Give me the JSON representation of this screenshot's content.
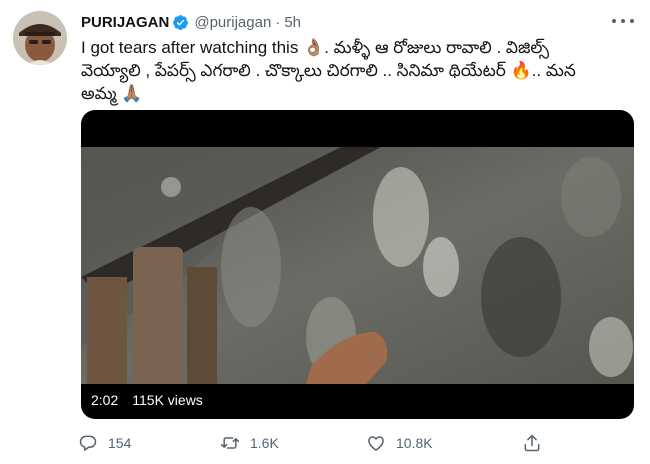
{
  "author": {
    "name": "PURIJAGAN",
    "handle": "@purijagan",
    "separator": "·",
    "time": "5h",
    "avatar_icon": "avatar-photo"
  },
  "tweet": {
    "lines": [
      "I got tears after watching this 👌🏽. మళ్ళీ ఆ రోజులు రావాలి . విజిల్స్",
      "వెయ్యాలి , పేపర్స్ ఎగరాలి . చొక్కాలు చిరగాలి .. సినిమా థియేటర్ 🔥.. మన",
      "అమ్మ 🙏🏽"
    ]
  },
  "video": {
    "duration": "2:02",
    "views": "115K views"
  },
  "actions": {
    "replies": "154",
    "retweets": "1.6K",
    "likes": "10.8K"
  },
  "colors": {
    "text": "#0f1419",
    "secondary": "#536471",
    "verified": "#1d9bf0"
  }
}
